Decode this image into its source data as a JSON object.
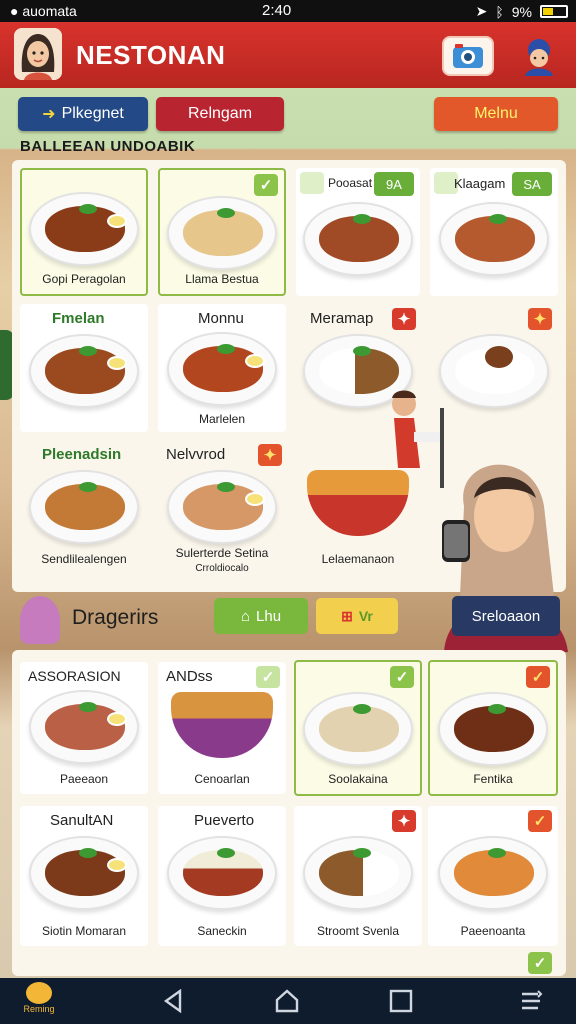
{
  "status_bar": {
    "left_text": "auomata",
    "time": "2:40",
    "battery": "9%"
  },
  "header": {
    "title": "NESTONAN"
  },
  "top_buttons": {
    "blue_label": "Plkegnet",
    "red_label": "Relngam",
    "orange_label": "Melnu"
  },
  "section_label": "BALLEEAN UNDOABIK",
  "top_panel": {
    "row1": [
      {
        "caption": "Gopi Peragolan",
        "selected": true,
        "check": "none"
      },
      {
        "caption": "Llama Bestua",
        "selected": true,
        "check": "green"
      },
      {
        "title": "Pooasat",
        "tag": "9A",
        "selected": false
      },
      {
        "title": "Klaagam",
        "tag": "SA",
        "selected": false
      }
    ],
    "row2": [
      {
        "title": "Fmelan"
      },
      {
        "title": "Monnu",
        "caption": "Marlelen"
      },
      {
        "title": "Meramap",
        "check": "red"
      },
      {
        "title": "",
        "check": "orange"
      }
    ],
    "row3": [
      {
        "title": "Pleenadsin",
        "caption": "Sendlilealengen"
      },
      {
        "title": "Nelvvrod",
        "check": "orange",
        "caption": "Sulerterde Setina",
        "sub": "Crroldiocalo"
      },
      {
        "caption": "Lelaemanaon"
      }
    ]
  },
  "mid_row": {
    "label": "Dragerirs",
    "green_label": "Lhu",
    "yellow_label": "Vr",
    "navy_label": "Sreloaaon"
  },
  "bottom_panel": {
    "row1": [
      {
        "title": "ASSORASION",
        "caption": "Paeeaon"
      },
      {
        "title": "ANDss",
        "caption": "Cenoarlan",
        "check": "green"
      },
      {
        "caption": "Soolakaina",
        "check": "green",
        "selected": true
      },
      {
        "caption": "Fentika",
        "check": "orange",
        "selected": true
      }
    ],
    "row2": [
      {
        "title": "SanultAN",
        "caption": "Siotin Momaran"
      },
      {
        "title": "Pueverto",
        "caption": "Saneckin"
      },
      {
        "caption": "Stroomt Svenla",
        "check": "red"
      },
      {
        "caption": "Paeenoanta",
        "check": "orange"
      }
    ]
  },
  "navbar": {
    "app_label": "Reming"
  },
  "colors": {
    "header_red": "#c92c25",
    "accent_green": "#8cc34a",
    "navy": "#283a64"
  }
}
